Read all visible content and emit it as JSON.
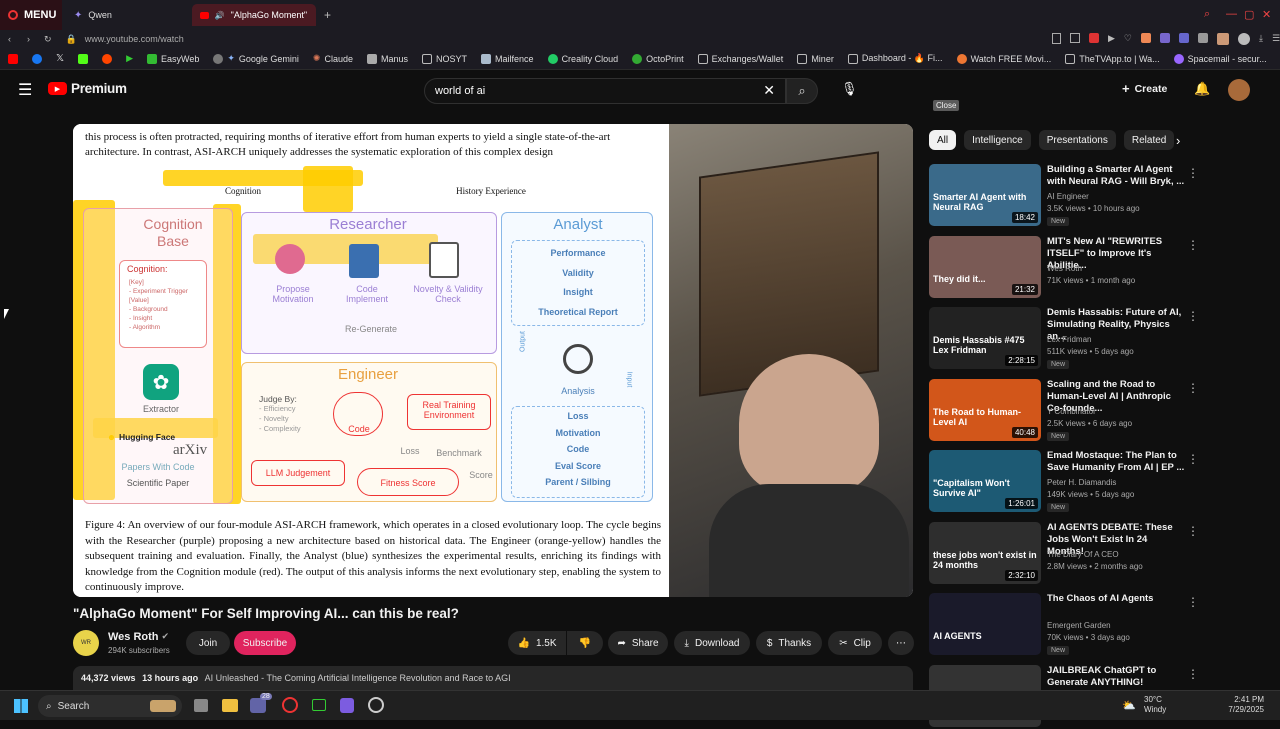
{
  "browser": {
    "menu_label": "MENU",
    "tabs": [
      {
        "label": "Qwen"
      },
      {
        "label": "\"AlphaGo Moment\" Fc"
      }
    ],
    "url": "www.youtube.com/watch",
    "bookmarks": [
      "EasyWeb",
      "Google Gemini",
      "Claude",
      "Manus",
      "NOSYT",
      "Mailfence",
      "Creality Cloud",
      "OctoPrint",
      "Exchanges/Wallet",
      "Miner",
      "Dashboard - 🔥 Fi...",
      "Watch FREE Movi...",
      "TheTVApp.to | Wa...",
      "Spacemail - secur..."
    ]
  },
  "youtube": {
    "logo_label": "Premium",
    "search_value": "world of ai",
    "create_label": "Create",
    "tooltip": "Close"
  },
  "paper": {
    "top_text": "this process is often protracted, requiring months of iterative effort from human experts to yield a single state-of-the-art architecture. In contrast, ASI-ARCH uniquely addresses the systematic exploration of this complex design",
    "cognition_label": "Cognition",
    "history_label": "History Experience",
    "cog_base": "Cognition Base",
    "cog_inner_title": "Cognition:",
    "cog_inner_lines": [
      "[Key]",
      "- Experiment Trigger",
      "[Value]",
      "- Background",
      "- Insight",
      "- Algorithm"
    ],
    "extractor": "Extractor",
    "hugging_face": "Hugging Face",
    "arxiv": "arXiv",
    "papers_with_code": "Papers With Code",
    "scientific_paper": "Scientific Paper",
    "researcher": "Researcher",
    "propose": "Propose Motivation",
    "code_impl": "Code Implement",
    "novelty": "Novelty & Validity Check",
    "regenerate": "Re-Generate",
    "engineer": "Engineer",
    "judge_by": "Judge By:",
    "judge_items": [
      "- Efficiency",
      "- Novelty",
      "- Complexity"
    ],
    "code": "Code",
    "real_training": "Real Training Environment",
    "llm_judgement": "LLM Judgement",
    "loss_lbl": "Loss",
    "benchmark": "Benchmark",
    "score": "Score",
    "fitness_score": "Fitness Score",
    "analyst": "Analyst",
    "analyst_items": [
      "Performance",
      "Validity",
      "Insight",
      "Theoretical Report"
    ],
    "output": "Output",
    "input": "Input",
    "analysis": "Analysis",
    "analyst_bottom": [
      "Loss",
      "Motivation",
      "Code",
      "Eval Score",
      "Parent / Silbing"
    ],
    "caption": "Figure 4: An overview of our four-module ASI-ARCH framework, which operates in a closed evolutionary loop. The cycle begins with the Researcher (purple) proposing a new architecture based on historical data. The Engineer (orange-yellow) handles the subsequent training and evaluation. Finally, the Analyst (blue) synthesizes the experimental results, enriching its findings with knowledge from the Cognition module (red). The output of this analysis informs the next evolutionary step, enabling the system to continuously improve."
  },
  "video": {
    "title": "\"AlphaGo Moment\" For Self Improving AI... can this be real?",
    "channel": "Wes Roth",
    "subscribers": "294K subscribers",
    "join": "Join",
    "subscribe": "Subscribe",
    "likes": "1.5K",
    "share": "Share",
    "download": "Download",
    "thanks": "Thanks",
    "clip": "Clip",
    "views": "44,372 views",
    "ago": "13 hours ago",
    "description": "AI Unleashed - The Coming Artificial Intelligence Revolution and Race to AGI"
  },
  "chips": [
    "All",
    "Intelligence",
    "Presentations",
    "Related"
  ],
  "recommendations": [
    {
      "title": "Building a Smarter AI Agent with Neural RAG - Will Bryk, ...",
      "channel": "AI Engineer",
      "meta": "3.5K views • 10 hours ago",
      "duration": "18:42",
      "badge": "New",
      "thumb_text": "Smarter AI Agent with Neural RAG",
      "color": "#3a6a8a"
    },
    {
      "title": "MIT's New AI \"REWRITES ITSELF\" to Improve It's Abilitie...",
      "channel": "Wes Roth",
      "meta": "71K views • 1 month ago",
      "duration": "21:32",
      "badge": "",
      "thumb_text": "They did it...",
      "color": "#7a5a55"
    },
    {
      "title": "Demis Hassabis: Future of AI, Simulating Reality, Physics an...",
      "channel": "Lex Fridman",
      "meta": "511K views • 5 days ago",
      "duration": "2:28:15",
      "badge": "New",
      "thumb_text": "Demis Hassabis #475 Lex Fridman",
      "color": "#222"
    },
    {
      "title": "Scaling and the Road to Human-Level AI | Anthropic Co-founde...",
      "channel": "Y Combinator",
      "meta": "2.5K views • 6 days ago",
      "duration": "40:48",
      "badge": "New",
      "thumb_text": "The Road to Human-Level AI",
      "color": "#d2561a"
    },
    {
      "title": "Emad Mostaque: The Plan to Save Humanity From AI | EP ...",
      "channel": "Peter H. Diamandis",
      "meta": "149K views • 5 days ago",
      "duration": "1:26:01",
      "badge": "New",
      "thumb_text": "\"Capitalism Won't Survive AI\"",
      "color": "#1d5a74"
    },
    {
      "title": "AI AGENTS DEBATE: These Jobs Won't Exist In 24 Months!",
      "channel": "The Diary Of A CEO",
      "meta": "2.8M views • 2 months ago",
      "duration": "2:32:10",
      "badge": "",
      "thumb_text": "these jobs won't exist in 24 months",
      "color": "#2e2e2e"
    },
    {
      "title": "The Chaos of AI Agents",
      "channel": "Emergent Garden",
      "meta": "70K views • 3 days ago",
      "duration": "",
      "badge": "New",
      "thumb_text": "AI AGENTS",
      "color": "#1a1a2a"
    },
    {
      "title": "JAILBREAK ChatGPT to Generate ANYTHING!",
      "channel": "",
      "meta": "",
      "duration": "",
      "badge": "",
      "thumb_text": "",
      "color": "#333"
    }
  ],
  "taskbar": {
    "search": "Search",
    "badge": "28",
    "weather_temp": "30°C",
    "weather_desc": "Windy",
    "time": "2:41 PM",
    "date": "7/29/2025"
  }
}
